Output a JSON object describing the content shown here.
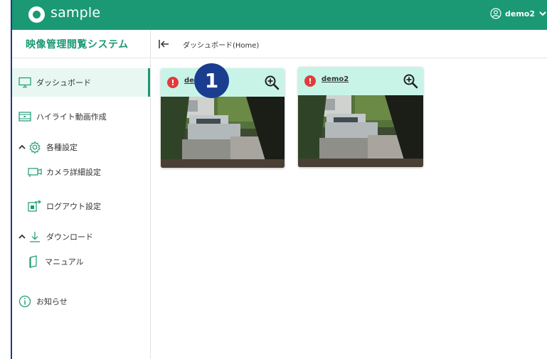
{
  "header": {
    "logo_text": "sample",
    "user_name": "demo2"
  },
  "titlebar": {
    "app_title": "映像管理閲覧システム",
    "breadcrumb": "ダッシュボード(Home)"
  },
  "sidebar": {
    "items": [
      {
        "label": "ダッシュボード",
        "icon": "monitor-icon",
        "active": true
      },
      {
        "label": "ハイライト動画作成",
        "icon": "film-icon"
      },
      {
        "label": "各種設定",
        "icon": "gear-icon",
        "expanded": true
      },
      {
        "label": "カメラ詳細設定",
        "icon": "camera-icon"
      },
      {
        "label": "ログアウト設定",
        "icon": "logout-icon"
      },
      {
        "label": "ダウンロード",
        "icon": "download-icon",
        "expanded": true
      },
      {
        "label": "マニュアル",
        "icon": "book-icon"
      },
      {
        "label": "お知らせ",
        "icon": "info-icon"
      }
    ]
  },
  "cards": [
    {
      "name": "demo2",
      "status": "warning",
      "visible_label": "de"
    },
    {
      "name": "demo2",
      "status": "warning",
      "visible_label": "demo2"
    }
  ],
  "step_badge": "1",
  "colors": {
    "brand": "#1a9974",
    "card_header": "#c8f4e8",
    "warning": "#e23b3b",
    "badge": "#1a3d8f"
  }
}
